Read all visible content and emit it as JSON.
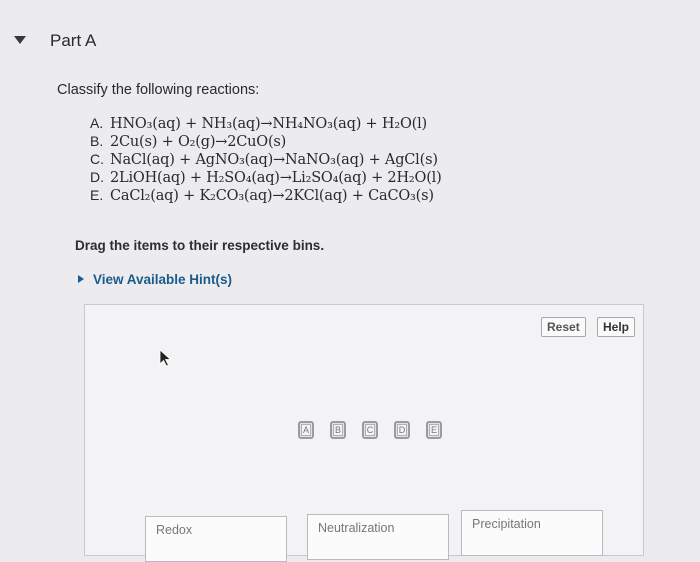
{
  "part": {
    "title": "Part A"
  },
  "question": "Classify the following reactions:",
  "reactions": [
    {
      "letter": "A.",
      "equation": "HNO₃(aq) + NH₃(aq)→NH₄NO₃(aq) + H₂O(l)"
    },
    {
      "letter": "B.",
      "equation": "2Cu(s) + O₂(g)→2CuO(s)"
    },
    {
      "letter": "C.",
      "equation": "NaCl(aq) + AgNO₃(aq)→NaNO₃(aq) + AgCl(s)"
    },
    {
      "letter": "D.",
      "equation": "2LiOH(aq) + H₂SO₄(aq)→Li₂SO₄(aq) + 2H₂O(l)"
    },
    {
      "letter": "E.",
      "equation": "CaCl₂(aq) + K₂CO₃(aq)→2KCl(aq) + CaCO₃(s)"
    }
  ],
  "instruction": "Drag the items to their respective bins.",
  "hint_link": "View Available Hint(s)",
  "buttons": {
    "reset": "Reset",
    "help": "Help"
  },
  "tiles": [
    "A",
    "B",
    "C",
    "D",
    "E"
  ],
  "bins": {
    "redox": "Redox",
    "neutralization": "Neutralization",
    "precipitation": "Precipitation"
  },
  "icons": {
    "toggle": "caret-down-icon",
    "hint": "caret-right-icon",
    "cursor": "mouse-pointer-icon"
  }
}
